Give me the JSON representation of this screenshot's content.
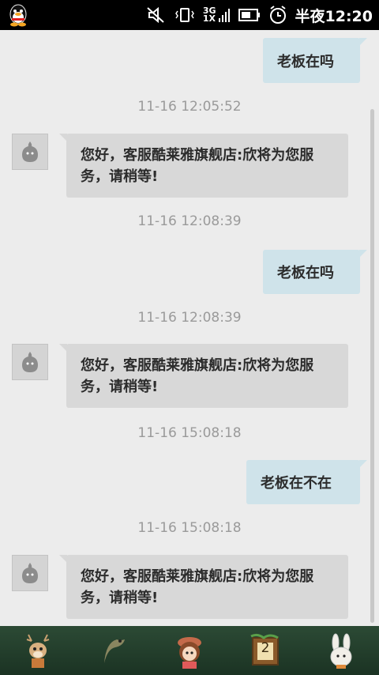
{
  "status_bar": {
    "network": "3G",
    "network_sub": "1X",
    "time": "半夜12:20"
  },
  "messages": [
    {
      "type": "out",
      "text": "老板在吗"
    },
    {
      "type": "time",
      "text": "11-16 12:05:52"
    },
    {
      "type": "in",
      "text": "您好，客服酷莱雅旗舰店:欣将为您服务，请稍等!"
    },
    {
      "type": "time",
      "text": "11-16 12:08:39"
    },
    {
      "type": "out",
      "text": "老板在吗"
    },
    {
      "type": "time",
      "text": "11-16 12:08:39"
    },
    {
      "type": "in",
      "text": "您好，客服酷莱雅旗舰店:欣将为您服务，请稍等!"
    },
    {
      "type": "time",
      "text": "11-16 15:08:18"
    },
    {
      "type": "out",
      "text": "老板在不在"
    },
    {
      "type": "time",
      "text": "11-16 15:08:18"
    },
    {
      "type": "in",
      "text": "您好，客服酷莱雅旗舰店:欣将为您服务，请稍等!"
    }
  ],
  "bottom_bar": {
    "items": [
      {
        "icon": "deer-icon"
      },
      {
        "icon": "lizard-icon"
      },
      {
        "icon": "girl-icon"
      },
      {
        "icon": "calendar-icon",
        "label": "2"
      },
      {
        "icon": "rabbit-icon"
      }
    ]
  },
  "colors": {
    "out_bubble": "#cfe3ea",
    "in_bubble": "#d8d8d8",
    "timestamp": "#9a9a9a",
    "bottom_bar": "#23402c"
  }
}
